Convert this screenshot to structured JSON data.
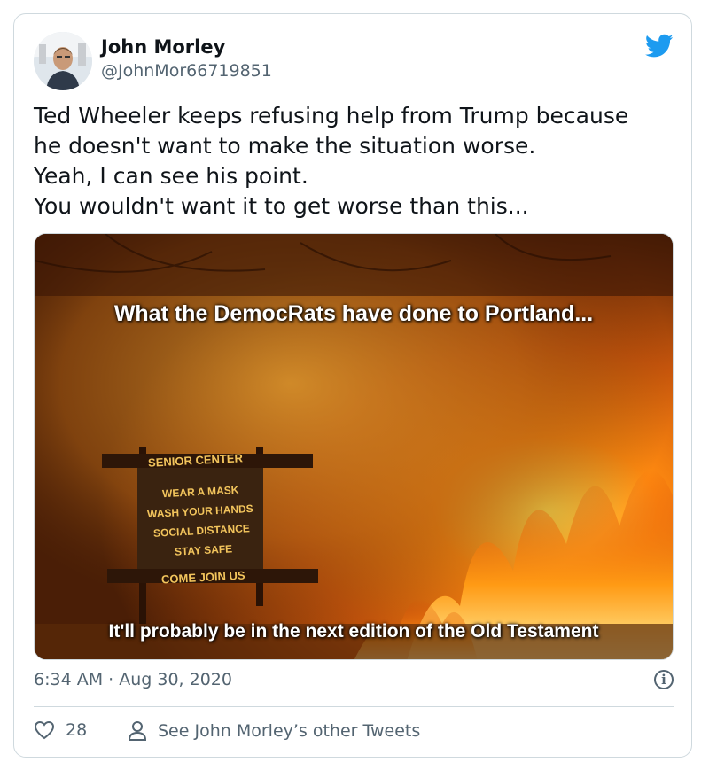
{
  "tweet": {
    "author_name": "John Morley",
    "author_handle": "@JohnMor66719851",
    "text_lines": [
      "Ted Wheeler keeps refusing help from Trump because",
      "he doesn't want to make the situation worse.",
      "Yeah, I can see his point.",
      "You wouldn't want it to get worse than this..."
    ],
    "timestamp": "6:34 AM · Aug 30, 2020",
    "like_count": "28",
    "other_tweets_label": "See John Morley’s other Tweets"
  },
  "media": {
    "caption_top": "What the DemocRats have done to Portland...",
    "caption_bottom": "It'll probably be in the next edition of the Old Testament",
    "sign_header": "SENIOR      CENTER",
    "sign_lines": [
      "WEAR A MASK",
      "WASH YOUR HANDS",
      "SOCIAL DISTANCE",
      "STAY SAFE"
    ],
    "sign_footer": "COME    JOIN    US"
  },
  "colors": {
    "brand": "#1d9bf0",
    "text": "#0f1419",
    "muted": "#536471",
    "border": "#cfd9de"
  },
  "icons": [
    "twitter-bird-icon",
    "info-icon",
    "heart-icon",
    "person-icon"
  ]
}
